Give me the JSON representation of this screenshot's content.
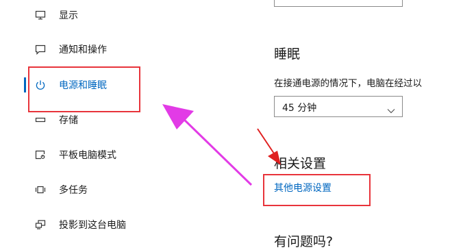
{
  "sidebar": {
    "items": [
      {
        "label": "显示",
        "icon": "monitor-icon"
      },
      {
        "label": "通知和操作",
        "icon": "notification-icon"
      },
      {
        "label": "电源和睡眠",
        "icon": "power-icon",
        "active": true
      },
      {
        "label": "存储",
        "icon": "storage-drive-icon"
      },
      {
        "label": "平板电脑模式",
        "icon": "tablet-mode-icon"
      },
      {
        "label": "多任务",
        "icon": "multitasking-icon"
      },
      {
        "label": "投影到这台电脑",
        "icon": "project-to-pc-icon"
      }
    ]
  },
  "main": {
    "sleep_title": "睡眠",
    "sleep_desc": "在接通电源的情况下，电脑在经过以",
    "sleep_select": {
      "value": "45 分钟"
    },
    "related_title": "相关设置",
    "related_link": "其他电源设置",
    "faq_title": "有问题吗?"
  },
  "colors": {
    "accent": "#0067c0",
    "highlight_box": "#e8333a",
    "arrow_magenta": "#e23be6",
    "arrow_red": "#e02020"
  }
}
